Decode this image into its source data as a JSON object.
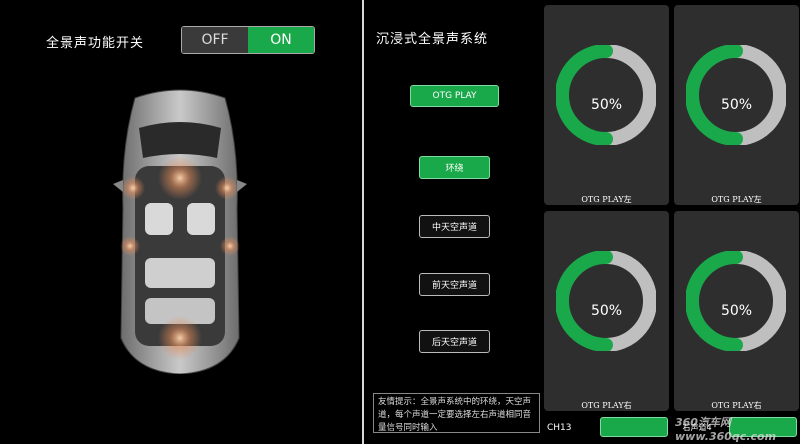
{
  "left": {
    "title": "全景声功能开关",
    "toggle": {
      "off_label": "OFF",
      "on_label": "ON",
      "selected": "ON"
    }
  },
  "right": {
    "title": "沉浸式全景声系统",
    "buttons": [
      {
        "label": "OTG PLAY",
        "active": true
      },
      {
        "label": "环绕",
        "active": true
      },
      {
        "label": "中天空声道",
        "active": false
      },
      {
        "label": "前天空声道",
        "active": false
      },
      {
        "label": "后天空声道",
        "active": false
      }
    ],
    "hint": "友情提示：全景声系统中的环绕，天空声道，每个声道一定要选择左右声道相同音量信号同时输入",
    "channel": "CH13",
    "channel_btn_2_label": "右声道4"
  },
  "gauges": [
    {
      "value": 50,
      "display": "50%",
      "label": "OTG PLAY左"
    },
    {
      "value": 50,
      "display": "50%",
      "label": "OTG PLAY左"
    },
    {
      "value": 50,
      "display": "50%",
      "label": "OTG PLAY右"
    },
    {
      "value": 50,
      "display": "50%",
      "label": "OTG PLAY右"
    }
  ],
  "colors": {
    "accent": "#1aa94a",
    "track": "#bfbfbf",
    "card_bg": "#2e2e2e"
  },
  "watermark": "360汽车网 www.360qc.com"
}
